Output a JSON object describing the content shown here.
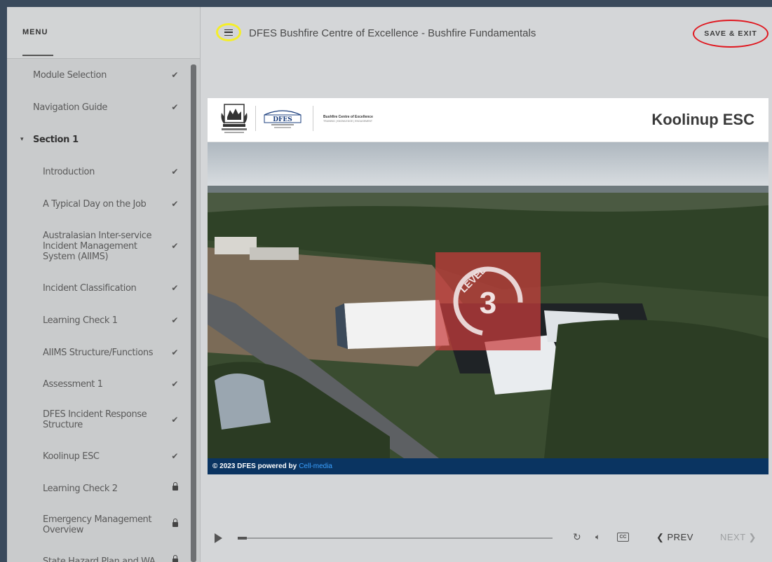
{
  "sidebar": {
    "title": "MENU",
    "items": [
      {
        "label": "Module Selection",
        "status": "check",
        "level": "top"
      },
      {
        "label": "Navigation Guide",
        "status": "check",
        "level": "top"
      },
      {
        "label": "Section 1",
        "status": "expanded",
        "level": "section"
      },
      {
        "label": "Introduction",
        "status": "check",
        "level": "sub"
      },
      {
        "label": "A Typical Day on the Job",
        "status": "check",
        "level": "sub"
      },
      {
        "label": "Australasian Inter-service Incident Management System (AIIMS)",
        "status": "check",
        "level": "sub"
      },
      {
        "label": "Incident Classification",
        "status": "check",
        "level": "sub"
      },
      {
        "label": "Learning Check 1",
        "status": "check",
        "level": "sub"
      },
      {
        "label": "AIIMS Structure/Functions",
        "status": "check",
        "level": "sub"
      },
      {
        "label": "Assessment 1",
        "status": "check",
        "level": "sub"
      },
      {
        "label": "DFES Incident Response Structure",
        "status": "check",
        "level": "sub"
      },
      {
        "label": "Koolinup ESC",
        "status": "check",
        "level": "sub"
      },
      {
        "label": "Learning Check 2",
        "status": "locked",
        "level": "sub"
      },
      {
        "label": "Emergency Management Overview",
        "status": "locked",
        "level": "sub"
      },
      {
        "label": "State Hazard Plan and WA",
        "status": "locked",
        "level": "sub"
      }
    ]
  },
  "topbar": {
    "menu_icon": "hamburger-icon",
    "course_title": "DFES Bushfire Centre of Excellence - Bushfire Fundamentals",
    "save_exit": "SAVE & EXIT"
  },
  "slide": {
    "logo_dfes": "DFES",
    "logo_bce_title": "Bushfire Centre of Excellence",
    "logo_bce_tagline": "TRAINING | KNOWLEDGE | ENGAGEMENT",
    "title": "Koolinup ESC",
    "badge_word": "LEVEL",
    "badge_number": "3",
    "footer_text": "© 2023 DFES powered by",
    "footer_brand": "Cell-media"
  },
  "controls": {
    "play_icon": "play-icon",
    "progress": 0.03,
    "replay_icon": "replay-icon",
    "audio_icon": "volume-icon",
    "cc_label": "CC",
    "prev_label": "PREV",
    "next_label": "NEXT",
    "next_enabled": false
  },
  "colors": {
    "highlight_hamburger": "#f4ee2a",
    "highlight_save": "#e0161e",
    "footer_bg": "#0a3461",
    "footer_brand": "#3aa0ff"
  }
}
